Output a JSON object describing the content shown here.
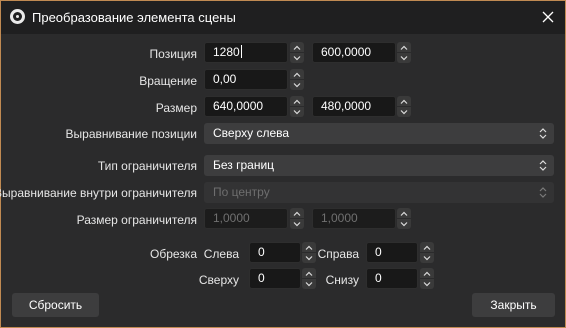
{
  "window": {
    "title": "Преобразование элемента сцены",
    "icon": "obs-logo-icon",
    "close_icon": "close-icon"
  },
  "position": {
    "label": "Позиция",
    "x": "1280",
    "y": "600,0000"
  },
  "rotation": {
    "label": "Вращение",
    "value": "0,00"
  },
  "size": {
    "label": "Размер",
    "width": "640,0000",
    "height": "480,0000"
  },
  "position_alignment": {
    "label": "Выравнивание позиции",
    "value": "Сверху слева"
  },
  "bounds_type": {
    "label": "Тип ограничителя",
    "value": "Без границ"
  },
  "bounds_alignment": {
    "label": "Выравнивание внутри ограничителя",
    "value": "По центру"
  },
  "bounds_size": {
    "label": "Размер ограничителя",
    "width": "1,0000",
    "height": "1,0000"
  },
  "crop": {
    "label": "Обрезка",
    "left_label": "Слева",
    "left": "0",
    "right_label": "Справа",
    "right": "0",
    "top_label": "Сверху",
    "top": "0",
    "bottom_label": "Снизу",
    "bottom": "0"
  },
  "buttons": {
    "reset": "Сбросить",
    "close": "Закрыть"
  },
  "colors": {
    "accent_border": "#c08a52",
    "background": "#2b2b2c",
    "field": "#181818"
  }
}
